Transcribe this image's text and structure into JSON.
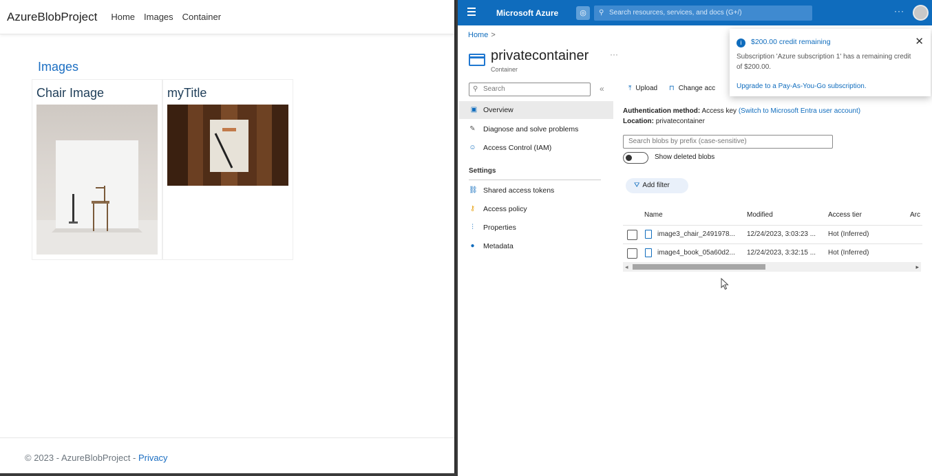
{
  "left": {
    "brand": "AzureBlobProject",
    "nav": [
      "Home",
      "Images",
      "Container"
    ],
    "heading": "Images",
    "cards": [
      {
        "title": "Chair Image"
      },
      {
        "title": "myTitle"
      }
    ],
    "footer": {
      "text": "© 2023 - AzureBlobProject - ",
      "privacy": "Privacy"
    }
  },
  "azure": {
    "title": "Microsoft Azure",
    "search_placeholder": "Search resources, services, and docs (G+/)",
    "more": "···",
    "breadcrumb": {
      "home": "Home",
      "sep": ">"
    },
    "container": {
      "name": "privatecontainer",
      "type": "Container",
      "more": "···"
    },
    "sidebar": {
      "search": "Search",
      "collapse": "«",
      "items": [
        "Overview",
        "Diagnose and solve problems",
        "Access Control (IAM)"
      ],
      "settings_header": "Settings",
      "settings_items": [
        "Shared access tokens",
        "Access policy",
        "Properties",
        "Metadata"
      ]
    },
    "toolbar": {
      "upload": "Upload",
      "change": "Change acc"
    },
    "auth": {
      "label": "Authentication method:",
      "value": "Access key",
      "link": "(Switch to Microsoft Entra user account)"
    },
    "location": {
      "label": "Location:",
      "value": "privatecontainer"
    },
    "blob_search_placeholder": "Search blobs by prefix (case-sensitive)",
    "show_deleted": "Show deleted blobs",
    "add_filter": "Add filter",
    "table": {
      "headers": [
        "Name",
        "Modified",
        "Access tier",
        "Arc"
      ],
      "rows": [
        {
          "name": "image3_chair_2491978...",
          "modified": "12/24/2023, 3:03:23 ...",
          "tier": "Hot (Inferred)"
        },
        {
          "name": "image4_book_05a60d2...",
          "modified": "12/24/2023, 3:32:15 ...",
          "tier": "Hot (Inferred)"
        }
      ]
    },
    "notification": {
      "title": "$200.00 credit remaining",
      "body": "Subscription 'Azure subscription 1' has a remaining credit of $200.00.",
      "link": "Upgrade to a Pay-As-You-Go subscription."
    }
  }
}
